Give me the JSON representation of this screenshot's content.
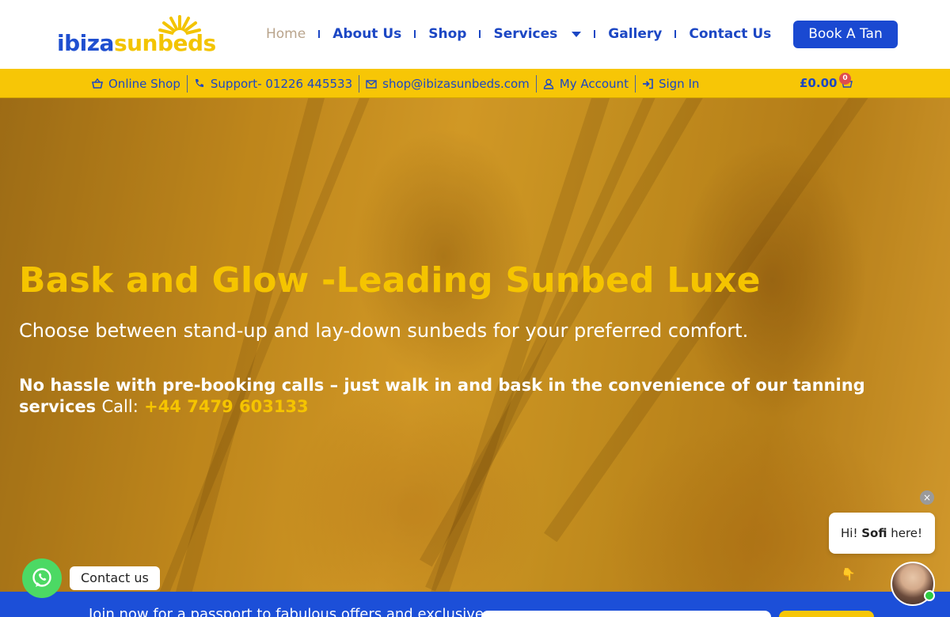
{
  "header": {
    "logo": {
      "part1": "ibiza",
      "part2": "sunbeds"
    },
    "nav": [
      {
        "label": "Home",
        "active": true
      },
      {
        "label": "About Us"
      },
      {
        "label": "Shop"
      },
      {
        "label": "Services",
        "has_dropdown": true
      },
      {
        "label": "Gallery"
      },
      {
        "label": "Contact Us"
      }
    ],
    "cta": "Book A Tan"
  },
  "infobar": {
    "items": [
      {
        "icon": "basket-icon",
        "label": "Online Shop"
      },
      {
        "icon": "phone-icon",
        "label": "Support- 01226 445533"
      },
      {
        "icon": "envelope-icon",
        "label": "shop@ibizasunbeds.com"
      },
      {
        "icon": "user-icon",
        "label": "My Account"
      },
      {
        "icon": "sign-in-icon",
        "label": "Sign In"
      }
    ],
    "cart": {
      "total": "£0.00",
      "count": "0"
    }
  },
  "hero": {
    "title": "Bask and Glow -Leading Sunbed Luxe",
    "subtitle": "Choose between stand-up and lay-down sunbeds for your preferred comfort.",
    "body": "No hassle with pre-booking calls – just walk in and bask in the convenience of our tanning services",
    "call_label": "Call:",
    "phone": "+44 7479 603133"
  },
  "whatsapp": {
    "label": "Contact us"
  },
  "chat": {
    "greeting_prefix": "Hi! ",
    "name": "Sofi",
    "greeting_suffix": " here!👇",
    "close": "×"
  },
  "banner": {
    "text": "Join now for a passport to fabulous offers and exclusive"
  },
  "colors": {
    "brand_blue": "#1c47c4",
    "brand_yellow": "#f7c606"
  }
}
